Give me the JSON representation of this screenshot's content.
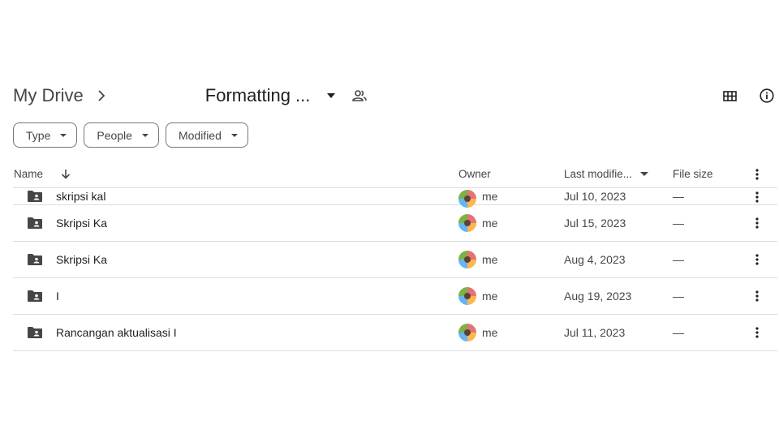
{
  "breadcrumb": {
    "root": "My Drive",
    "current": "Formatting ..."
  },
  "filters": {
    "type": "Type",
    "people": "People",
    "modified": "Modified"
  },
  "columns": {
    "name": "Name",
    "owner": "Owner",
    "last_modified": "Last modifie...",
    "file_size": "File size"
  },
  "rows": [
    {
      "name": "skripsi kal",
      "owner": "me",
      "modified": "Jul 10, 2023",
      "size": "—"
    },
    {
      "name": "Skripsi Ka",
      "owner": "me",
      "modified": "Jul 15, 2023",
      "size": "—"
    },
    {
      "name": "Skripsi Ka",
      "owner": "me",
      "modified": "Aug 4, 2023",
      "size": "—"
    },
    {
      "name": "I",
      "owner": "me",
      "modified": "Aug 19, 2023",
      "size": "—"
    },
    {
      "name": "Rancangan aktualisasi I",
      "owner": "me",
      "modified": "Jul 11, 2023",
      "size": "—"
    }
  ],
  "icons": {
    "folder": "shared-folder-icon",
    "grid": "grid-view-icon",
    "info": "info-icon",
    "share": "people-icon",
    "more": "more-vert-icon"
  },
  "colors": {
    "text": "#1f1f1f",
    "secondary": "#444746",
    "divider": "#dadce0",
    "folder": "#444746"
  }
}
